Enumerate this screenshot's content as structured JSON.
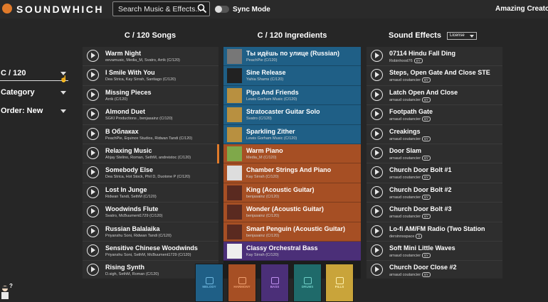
{
  "header": {
    "logo_text": "SOUNDWHICH",
    "search_placeholder": "Search Music & Effects...",
    "sync_label": "Sync Mode",
    "user_name": "Amazing Creator"
  },
  "filters": {
    "key_tempo": "C / 120",
    "category": "Category",
    "order": "Order: New"
  },
  "columns": {
    "songs_title": "C / 120 Songs",
    "ingredients_title": "C / 120 Ingredients",
    "effects_title": "Sound Effects",
    "license_label": "License"
  },
  "songs": [
    {
      "title": "Warm Night",
      "sub": "eevamusic, Media_M, Svatro, Arrik (C/120)"
    },
    {
      "title": "I Smile With You",
      "sub": "Dea Strica, Kay Sirrah, Santiago (C/120)"
    },
    {
      "title": "Missing Pieces",
      "sub": "Arrik (C/120)"
    },
    {
      "title": "Almond Duet",
      "sub": "SGKI Productions , benjasainz (C/120)"
    },
    {
      "title": "В Облаках",
      "sub": "PeachPie, Equinox Studios, Ridwan Tandi (C/120)"
    },
    {
      "title": "Relaxing Music",
      "sub": "Ahjay Stelino, Roman, SethM, andreistoc (C/120)"
    },
    {
      "title": "Somebody Else",
      "sub": "Dea Strica, Hot Stock, Phil D, Duotone P (C/120)"
    },
    {
      "title": "Lost In Junge",
      "sub": "Ridwan Tandi, SethM (C/120)"
    },
    {
      "title": "Woodwinds Flute",
      "sub": "Svatro, McBuument1729 (C/120)"
    },
    {
      "title": "Russian Balalaika",
      "sub": "Priyanshu Soni, Ridwan Tandi (C/120)"
    },
    {
      "title": "Sensitive Chinese Woodwinds",
      "sub": "Priyanshu Soni, SethM, McBuument1729 (C/120)"
    },
    {
      "title": "Rising Synth",
      "sub": "D.sigh, SethM, Roman (C/120)"
    }
  ],
  "ingredients": [
    {
      "title_a": "Ты идёшь по улице ",
      "title_b": "(Russian)",
      "sub": "PeachPie (C/120)",
      "bg": "#1f5f86",
      "thumb": "#777"
    },
    {
      "title_a": "Sine Release",
      "title_b": "",
      "sub": "Yahia Shams (C/120)",
      "bg": "#1f5f86",
      "thumb": "#222"
    },
    {
      "title_a": "Pipa And Friends",
      "title_b": "",
      "sub": "Lewis Gorham Music (C/120)",
      "bg": "#1f5f86",
      "thumb": "#b89040"
    },
    {
      "title_a": "Stratocaster Guitar Solo",
      "title_b": "",
      "sub": "Svatro (C/120)",
      "bg": "#1f5f86",
      "thumb": "#b89040"
    },
    {
      "title_a": "Sparkling Zither",
      "title_b": "",
      "sub": "Lewis Gorham Music (C/120)",
      "bg": "#1f5f86",
      "thumb": "#b89040"
    },
    {
      "title_a": "Warm Piano",
      "title_b": "",
      "sub": "Media_M (C/120)",
      "bg": "#a64f24",
      "thumb": "#7fa84a"
    },
    {
      "title_a": "Chamber Strings And Piano",
      "title_b": "",
      "sub": "Kay Sirrah (C/120)",
      "bg": "#a64f24",
      "thumb": "#ddd"
    },
    {
      "title_a": "King (Acoustic Guitar)",
      "title_b": "",
      "sub": "benjasainz (C/120)",
      "bg": "#a64f24",
      "thumb": "#5a2a20"
    },
    {
      "title_a": "Wonder (Acoustic Guitar)",
      "title_b": "",
      "sub": "benjasainz (C/120)",
      "bg": "#a64f24",
      "thumb": "#5a2a20"
    },
    {
      "title_a": "Smart Penguin (Acoustic Guitar)",
      "title_b": "",
      "sub": "benjasainz (C/120)",
      "bg": "#a64f24",
      "thumb": "#5a2a20"
    },
    {
      "title_a": "Classy Orchestral Bass",
      "title_b": "",
      "sub": "Kay Sirrah (C/120)",
      "bg": "#4b2f78",
      "thumb": "#eee"
    }
  ],
  "effects": [
    {
      "title": "07114 Hindu Fall Ding",
      "sub": "Robinhood76",
      "badge": "BY"
    },
    {
      "title": "Steps, Open Gate And Close STE",
      "sub": "arnaud coutancier",
      "badge": "BY"
    },
    {
      "title": "Latch Open And Close",
      "sub": "arnaud coutancier",
      "badge": "BY"
    },
    {
      "title": "Footpath Gate",
      "sub": "arnaud coutancier",
      "badge": "BY"
    },
    {
      "title": "Creakings",
      "sub": "arnaud coutancier",
      "badge": "BY"
    },
    {
      "title": "Door Slam",
      "sub": "arnaud coutancier",
      "badge": "BY"
    },
    {
      "title": "Church Door Bolt #1",
      "sub": "arnaud coutancier",
      "badge": "BY"
    },
    {
      "title": "Church Door Bolt #2",
      "sub": "arnaud coutancier",
      "badge": "BY"
    },
    {
      "title": "Church Door Bolt #3",
      "sub": "arnaud coutancier",
      "badge": "BY"
    },
    {
      "title": "Lo-fi AM/FM Radio (Two Station",
      "sub": "dersinnsspace",
      "badge": "0"
    },
    {
      "title": "Soft Mini Little Waves",
      "sub": "arnaud coutancier",
      "badge": "BY"
    },
    {
      "title": "Church Door Close #2",
      "sub": "arnaud coutancier",
      "badge": "BY"
    }
  ],
  "dock": [
    {
      "label": "MELODY",
      "color": "#1f5f86",
      "text": "#6fb8e0"
    },
    {
      "label": "HARMONY",
      "color": "#a64f24",
      "text": "#f0a070"
    },
    {
      "label": "BASS",
      "color": "#4b2f78",
      "text": "#c090f0"
    },
    {
      "label": "DRUMS",
      "color": "#1f6a6a",
      "text": "#70d0c8"
    },
    {
      "label": "FILLS",
      "color": "#c9a43a",
      "text": "#fff2b0"
    }
  ],
  "colors": {
    "accent": "#e07a2a",
    "melody": "#1f5f86",
    "harmony": "#a64f24",
    "bass": "#4b2f78"
  }
}
